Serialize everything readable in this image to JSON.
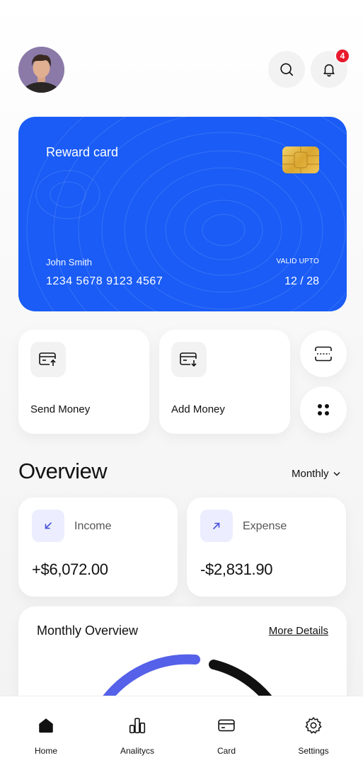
{
  "header": {
    "notification_count": "4"
  },
  "card": {
    "title": "Reward card",
    "holder_name": "John Smith",
    "number": "1234  5678  9123  4567",
    "valid_label": "VALID UPTO",
    "valid_value": "12 / 28",
    "color": "#1a5cf5"
  },
  "actions": {
    "send_label": "Send Money",
    "add_label": "Add Money"
  },
  "overview": {
    "title": "Overview",
    "period": "Monthly",
    "income_label": "Income",
    "income_value": "+$6,072.00",
    "expense_label": "Expense",
    "expense_value": "-$2,831.90"
  },
  "monthly": {
    "title": "Monthly Overview",
    "more_label": "More Details",
    "accent_color": "#5561e8"
  },
  "nav": {
    "home": "Home",
    "analytics": "Analitycs",
    "card": "Card",
    "settings": "Settings"
  }
}
